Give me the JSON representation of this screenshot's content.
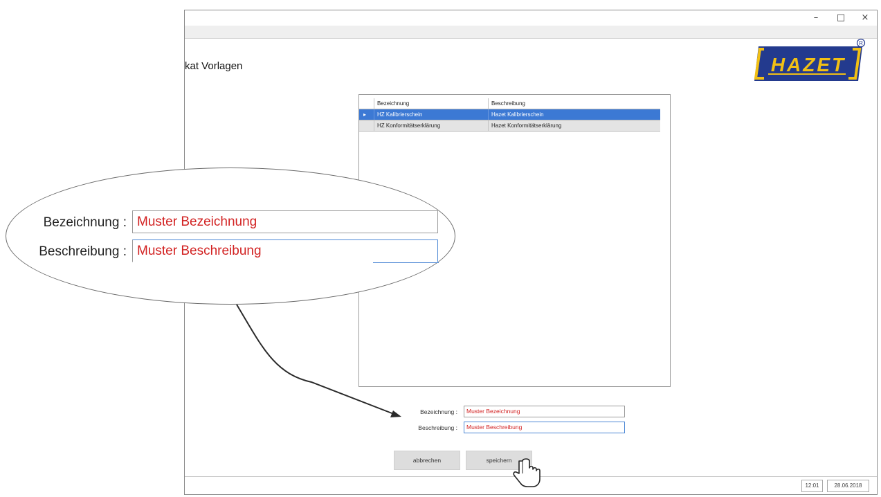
{
  "window": {
    "controls": {
      "minimize": "–",
      "maximize": "□",
      "close": "×"
    },
    "title": "kat Vorlagen"
  },
  "logo": {
    "text": "HAZET",
    "mark": "®",
    "colors": {
      "background": "#233a8e",
      "accent": "#f2c014"
    }
  },
  "table": {
    "columns": [
      "Bezeichnung",
      "Beschreibung"
    ],
    "rows": [
      {
        "indicator": "▸",
        "bezeichnung": "HZ Kalibrierschein",
        "beschreibung": "Hazet Kalibrierschein",
        "selected": true
      },
      {
        "indicator": "",
        "bezeichnung": "HZ Konformitätserklärung",
        "beschreibung": "Hazet Konformitätserklärung",
        "selected": false
      }
    ]
  },
  "form": {
    "bezeichnung_label": "Bezeichnung :",
    "bezeichnung_value": "Muster Bezeichnung",
    "beschreibung_label": "Beschreibung :",
    "beschreibung_value": "Muster Beschreibung"
  },
  "buttons": {
    "cancel": "abbrechen",
    "save": "speichern"
  },
  "status": {
    "time": "12:01",
    "date": "28.06.2018"
  },
  "colors": {
    "selection": "#3c79d4",
    "input_text": "#d22222"
  },
  "icons": [
    "hand-pointer-icon",
    "row-indicator-icon"
  ]
}
